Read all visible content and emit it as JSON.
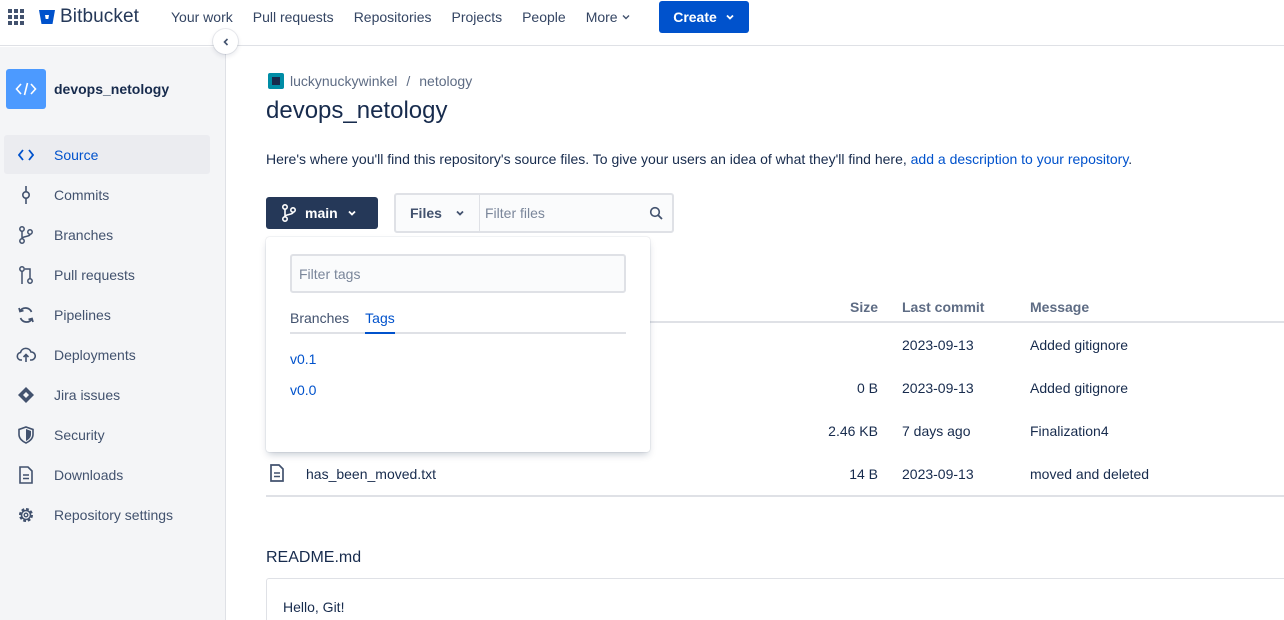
{
  "topnav": {
    "brand": "Bitbucket",
    "links": [
      {
        "label": "Your work"
      },
      {
        "label": "Pull requests"
      },
      {
        "label": "Repositories"
      },
      {
        "label": "Projects"
      },
      {
        "label": "People"
      },
      {
        "label": "More"
      }
    ],
    "create_label": "Create"
  },
  "sidebar": {
    "repo_name": "devops_netology",
    "items": [
      {
        "label": "Source",
        "icon": "code-icon",
        "active": true
      },
      {
        "label": "Commits",
        "icon": "commit-icon"
      },
      {
        "label": "Branches",
        "icon": "branch-icon"
      },
      {
        "label": "Pull requests",
        "icon": "pull-request-icon"
      },
      {
        "label": "Pipelines",
        "icon": "pipelines-icon"
      },
      {
        "label": "Deployments",
        "icon": "deployments-icon"
      },
      {
        "label": "Jira issues",
        "icon": "jira-icon"
      },
      {
        "label": "Security",
        "icon": "shield-icon"
      },
      {
        "label": "Downloads",
        "icon": "downloads-icon"
      },
      {
        "label": "Repository settings",
        "icon": "gear-icon"
      }
    ]
  },
  "breadcrumb": {
    "workspace": "luckynuckywinkel",
    "separator": "/",
    "project": "netology"
  },
  "page": {
    "title": "devops_netology",
    "intro_text": "Here's where you'll find this repository's source files. To give your users an idea of what they'll find here, ",
    "intro_link": "add a description to your repository",
    "intro_end": "."
  },
  "toolbar": {
    "branch": "main",
    "files_select": "Files",
    "filter_placeholder": "Filter files"
  },
  "table": {
    "headers": {
      "size": "Size",
      "last_commit": "Last commit",
      "message": "Message"
    },
    "rows": [
      {
        "name": "",
        "size": "",
        "date": "2023-09-13",
        "message": "Added gitignore"
      },
      {
        "name": "",
        "size": "0 B",
        "date": "2023-09-13",
        "message": "Added gitignore"
      },
      {
        "name": "",
        "size": "2.46 KB",
        "date": "7 days ago",
        "message": "Finalization4"
      },
      {
        "name": "has_been_moved.txt",
        "size": "14 B",
        "date": "2023-09-13",
        "message": "moved and deleted"
      }
    ]
  },
  "readme": {
    "title": "README.md",
    "content": "Hello, Git!"
  },
  "dropdown": {
    "filter_placeholder": "Filter tags",
    "tabs": [
      {
        "label": "Branches",
        "active": false
      },
      {
        "label": "Tags",
        "active": true
      }
    ],
    "tags": [
      "v0.1",
      "v0.0"
    ]
  },
  "colors": {
    "brand": "#0052cc",
    "branch_button": "#253858",
    "sidebar_bg": "#f4f5f7",
    "repo_avatar": "#4c9aff"
  }
}
